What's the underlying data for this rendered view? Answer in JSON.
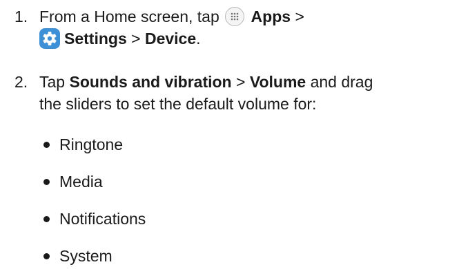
{
  "steps": [
    {
      "number": "1.",
      "t1": "From a Home screen, tap",
      "apps_icon": "apps-grid-icon",
      "apps": "Apps",
      "sep1": ">",
      "settings_icon": "gear-icon",
      "settings": "Settings",
      "sep2": ">",
      "device": "Device",
      "end": "."
    },
    {
      "number": "2.",
      "t1": "Tap",
      "sounds": "Sounds and vibration",
      "sep": ">",
      "volume": "Volume",
      "t2": "and drag",
      "line2": "the sliders to set the default volume for:"
    }
  ],
  "bullets": [
    "Ringtone",
    "Media",
    "Notifications",
    "System"
  ],
  "colors": {
    "text": "#1a1a1a",
    "settings_icon_bg": "#3d8fd6",
    "apps_icon_bg": "#f4f4f4"
  }
}
